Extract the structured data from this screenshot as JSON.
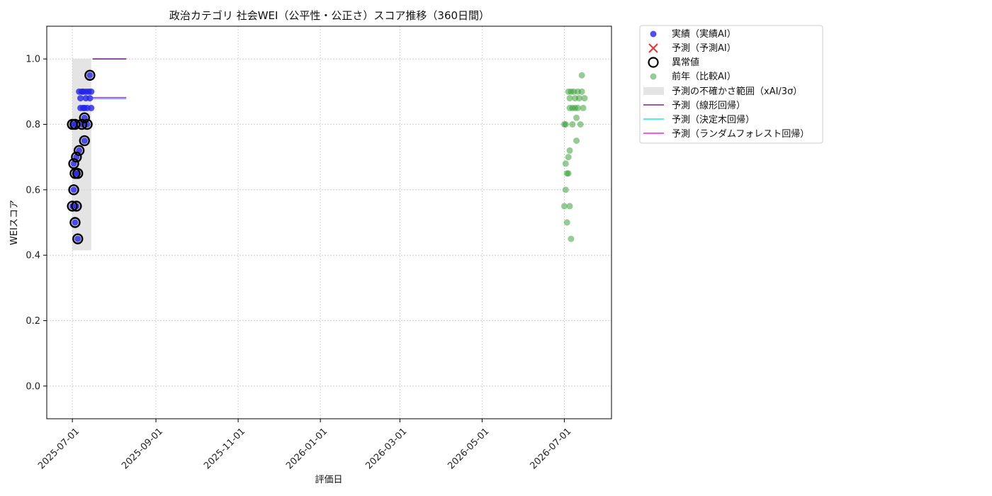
{
  "chart_data": {
    "type": "scatter",
    "title": "政治カテゴリ 社会WEI（公平性・公正さ）スコア推移（360日間）",
    "xlabel": "評価日",
    "ylabel": "WEIスコア",
    "xlim": [
      "2025-06-12",
      "2026-08-05"
    ],
    "ylim": [
      -0.1,
      1.1
    ],
    "x_ticks": [
      "2025-07-01",
      "2025-09-01",
      "2025-11-01",
      "2026-01-01",
      "2026-03-01",
      "2026-05-01",
      "2026-07-01"
    ],
    "y_ticks": [
      0.0,
      0.2,
      0.4,
      0.6,
      0.8,
      1.0
    ],
    "y_tick_labels": [
      "0.0",
      "0.2",
      "0.4",
      "0.6",
      "0.8",
      "1.0"
    ],
    "grid": true,
    "legend_position": "outside-right-top",
    "colors": {
      "actual": "#2222ee",
      "forecast_x": "#ee3333",
      "anomaly": "#000000",
      "previous_year": "#2a9a2a",
      "band": "#d9d9d9",
      "linear": "#8a1a9a",
      "tree": "#22e6e6",
      "forest": "#ee22ee"
    },
    "series": [
      {
        "name": "実績（実績AI）",
        "kind": "scatter",
        "points": [
          [
            "2025-07-01",
            0.55
          ],
          [
            "2025-07-01",
            0.8
          ],
          [
            "2025-07-02",
            0.68
          ],
          [
            "2025-07-02",
            0.6
          ],
          [
            "2025-07-03",
            0.65
          ],
          [
            "2025-07-03",
            0.8
          ],
          [
            "2025-07-03",
            0.5
          ],
          [
            "2025-07-04",
            0.7
          ],
          [
            "2025-07-04",
            0.55
          ],
          [
            "2025-07-05",
            0.65
          ],
          [
            "2025-07-05",
            0.45
          ],
          [
            "2025-07-06",
            0.72
          ],
          [
            "2025-07-06",
            0.9
          ],
          [
            "2025-07-07",
            0.85
          ],
          [
            "2025-07-07",
            0.88
          ],
          [
            "2025-07-08",
            0.9
          ],
          [
            "2025-07-08",
            0.8
          ],
          [
            "2025-07-09",
            0.85
          ],
          [
            "2025-07-09",
            0.9
          ],
          [
            "2025-07-10",
            0.75
          ],
          [
            "2025-07-10",
            0.82
          ],
          [
            "2025-07-10",
            0.85
          ],
          [
            "2025-07-11",
            0.88
          ],
          [
            "2025-07-11",
            0.9
          ],
          [
            "2025-07-12",
            0.85
          ],
          [
            "2025-07-12",
            0.8
          ],
          [
            "2025-07-13",
            0.9
          ],
          [
            "2025-07-14",
            0.95
          ],
          [
            "2025-07-14",
            0.88
          ],
          [
            "2025-07-15",
            0.9
          ],
          [
            "2025-07-15",
            0.85
          ]
        ]
      },
      {
        "name": "予測（予測AI）",
        "kind": "scatter-x",
        "points": []
      },
      {
        "name": "異常値",
        "kind": "ring",
        "points": [
          [
            "2025-07-01",
            0.55
          ],
          [
            "2025-07-01",
            0.8
          ],
          [
            "2025-07-02",
            0.68
          ],
          [
            "2025-07-02",
            0.6
          ],
          [
            "2025-07-03",
            0.65
          ],
          [
            "2025-07-03",
            0.8
          ],
          [
            "2025-07-03",
            0.5
          ],
          [
            "2025-07-04",
            0.7
          ],
          [
            "2025-07-04",
            0.55
          ],
          [
            "2025-07-05",
            0.65
          ],
          [
            "2025-07-05",
            0.45
          ],
          [
            "2025-07-06",
            0.72
          ],
          [
            "2025-07-08",
            0.8
          ],
          [
            "2025-07-10",
            0.75
          ],
          [
            "2025-07-10",
            0.82
          ],
          [
            "2025-07-12",
            0.8
          ],
          [
            "2025-07-14",
            0.95
          ]
        ]
      },
      {
        "name": "前年（比較AI）",
        "kind": "scatter-faded",
        "points": [
          [
            "2026-07-01",
            0.55
          ],
          [
            "2026-07-01",
            0.8
          ],
          [
            "2026-07-02",
            0.68
          ],
          [
            "2026-07-02",
            0.6
          ],
          [
            "2026-07-02",
            0.8
          ],
          [
            "2026-07-03",
            0.65
          ],
          [
            "2026-07-03",
            0.5
          ],
          [
            "2026-07-04",
            0.7
          ],
          [
            "2026-07-04",
            0.65
          ],
          [
            "2026-07-04",
            0.9
          ],
          [
            "2026-07-05",
            0.55
          ],
          [
            "2026-07-05",
            0.72
          ],
          [
            "2026-07-05",
            0.85
          ],
          [
            "2026-07-05",
            0.88
          ],
          [
            "2026-07-06",
            0.45
          ],
          [
            "2026-07-06",
            0.9
          ],
          [
            "2026-07-07",
            0.85
          ],
          [
            "2026-07-07",
            0.8
          ],
          [
            "2026-07-08",
            0.9
          ],
          [
            "2026-07-09",
            0.85
          ],
          [
            "2026-07-09",
            0.88
          ],
          [
            "2026-07-10",
            0.75
          ],
          [
            "2026-07-10",
            0.82
          ],
          [
            "2026-07-11",
            0.9
          ],
          [
            "2026-07-11",
            0.85
          ],
          [
            "2026-07-12",
            0.88
          ],
          [
            "2026-07-13",
            0.8
          ],
          [
            "2026-07-14",
            0.95
          ],
          [
            "2026-07-14",
            0.9
          ],
          [
            "2026-07-15",
            0.85
          ],
          [
            "2026-07-16",
            0.88
          ]
        ]
      },
      {
        "name": "予測の不確かさ範囲（xAI/3σ）",
        "kind": "band",
        "x": [
          "2025-07-01",
          "2025-07-15"
        ],
        "y": [
          0.415,
          1.0
        ]
      },
      {
        "name": "予測（線形回帰）",
        "kind": "line",
        "points": [
          [
            "2025-07-16",
            1.0
          ],
          [
            "2025-08-10",
            1.0
          ]
        ]
      },
      {
        "name": "予測（決定木回帰）",
        "kind": "line",
        "points": [
          [
            "2025-07-16",
            0.878
          ],
          [
            "2025-08-10",
            0.878
          ]
        ]
      },
      {
        "name": "予測（ランダムフォレスト回帰）",
        "kind": "line",
        "points": [
          [
            "2025-07-16",
            0.882
          ],
          [
            "2025-08-10",
            0.882
          ]
        ]
      }
    ]
  }
}
